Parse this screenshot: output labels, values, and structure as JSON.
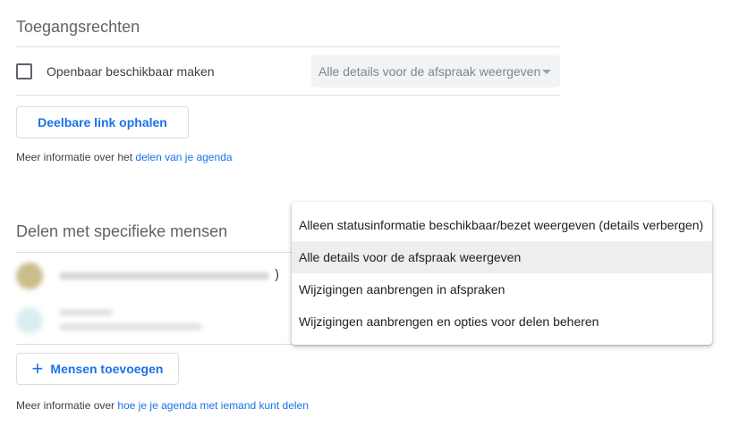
{
  "access": {
    "title": "Toegangsrechten",
    "public_label": "Openbaar beschikbaar maken",
    "public_checked": false,
    "select_value": "Alle details voor de afspraak weergeven",
    "share_link_button": "Deelbare link ophalen",
    "info_prefix": "Meer informatie over het",
    "info_link": "delen van je agenda"
  },
  "specific": {
    "title": "Delen met specifieke mensen",
    "paren": ")",
    "add_people_button": "Mensen toevoegen",
    "info_prefix": "Meer informatie over",
    "info_link": "hoe je je agenda met iemand kunt delen"
  },
  "permission_menu": {
    "items": [
      "Alleen statusinformatie beschikbaar/bezet weergeven (details verbergen)",
      "Alle details voor de afspraak weergeven",
      "Wijzigingen aanbrengen in afspraken",
      "Wijzigingen aanbrengen en opties voor delen beheren"
    ],
    "selected_index": 1
  },
  "colors": {
    "accent": "#1a73e8",
    "divider": "#dadce0",
    "selected_item_bg": "#eeeeee"
  }
}
